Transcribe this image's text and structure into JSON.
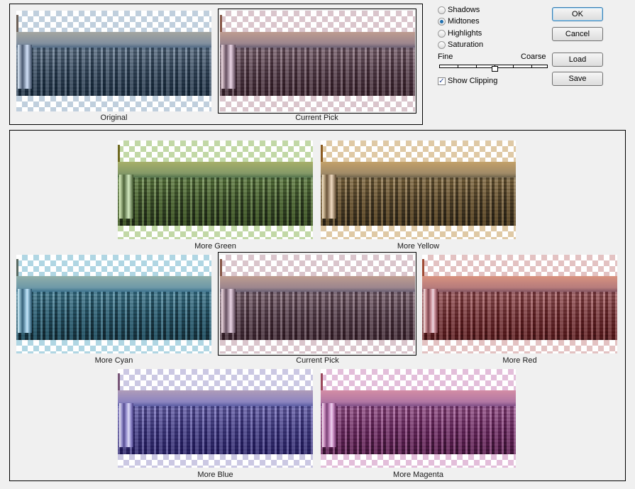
{
  "options": {
    "radios": [
      {
        "label": "Shadows",
        "checked": false
      },
      {
        "label": "Midtones",
        "checked": true
      },
      {
        "label": "Highlights",
        "checked": false
      },
      {
        "label": "Saturation",
        "checked": false
      }
    ],
    "slider": {
      "min_label": "Fine",
      "max_label": "Coarse",
      "position_step": 3,
      "steps": 7
    },
    "show_clipping": {
      "label": "Show Clipping",
      "checked": true
    }
  },
  "buttons": {
    "ok": "OK",
    "cancel": "Cancel",
    "load": "Load",
    "save": "Save"
  },
  "top": {
    "original": "Original",
    "current": "Current Pick"
  },
  "variations": [
    {
      "label": "More Green",
      "tint": "#70a030"
    },
    {
      "label": "More Yellow",
      "tint": "#c09040"
    },
    {
      "label": "More Cyan",
      "tint": "#3090b0"
    },
    {
      "label": "Current Pick",
      "tint": "#a07080"
    },
    {
      "label": "More Red",
      "tint": "#c04040"
    },
    {
      "label": "More Blue",
      "tint": "#5040c0"
    },
    {
      "label": "More Magenta",
      "tint": "#b03090"
    }
  ],
  "original_tint": "#6080a0"
}
